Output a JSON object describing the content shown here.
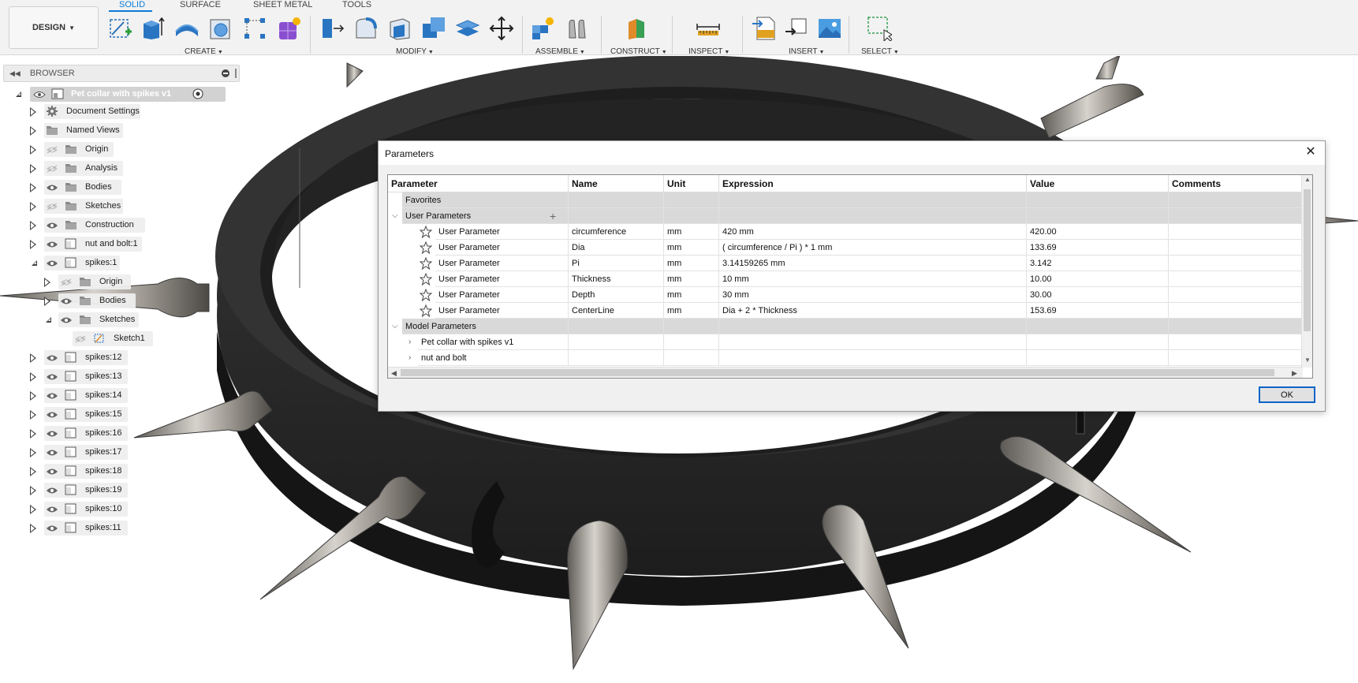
{
  "toolbar": {
    "workspace_label": "DESIGN",
    "tabs": [
      "SOLID",
      "SURFACE",
      "SHEET METAL",
      "TOOLS"
    ],
    "groups": [
      "CREATE",
      "MODIFY",
      "ASSEMBLE",
      "CONSTRUCT",
      "INSPECT",
      "INSERT",
      "SELECT"
    ]
  },
  "browser": {
    "title": "BROWSER",
    "root": "Pet collar with spikes v1",
    "items": [
      "Document Settings",
      "Named Views",
      "Origin",
      "Analysis",
      "Bodies",
      "Sketches",
      "Construction",
      "nut and bolt:1",
      "spikes:1",
      "Origin",
      "Bodies",
      "Sketches",
      "Sketch1",
      "spikes:12",
      "spikes:13",
      "spikes:14",
      "spikes:15",
      "spikes:16",
      "spikes:17",
      "spikes:18",
      "spikes:19",
      "spikes:10",
      "spikes:11"
    ]
  },
  "dialog": {
    "title": "Parameters",
    "close_glyph": "✕",
    "ok_label": "OK",
    "columns": [
      "Parameter",
      "Name",
      "Unit",
      "Expression",
      "Value",
      "Comments"
    ],
    "sections": {
      "favorites": "Favorites",
      "user": "User Parameters",
      "model": "Model Parameters"
    },
    "add_glyph": "+",
    "user_rows": [
      {
        "param": "User Parameter",
        "name": "circumference",
        "unit": "mm",
        "expr": "420 mm",
        "value": "420.00"
      },
      {
        "param": "User Parameter",
        "name": "Dia",
        "unit": "mm",
        "expr": "( circumference / Pi ) * 1 mm",
        "value": "133.69"
      },
      {
        "param": "User Parameter",
        "name": "Pi",
        "unit": "mm",
        "expr": "3.14159265 mm",
        "value": "3.142"
      },
      {
        "param": "User Parameter",
        "name": "Thickness",
        "unit": "mm",
        "expr": "10 mm",
        "value": "10.00"
      },
      {
        "param": "User Parameter",
        "name": "Depth",
        "unit": "mm",
        "expr": "30 mm",
        "value": "30.00"
      },
      {
        "param": "User Parameter",
        "name": "CenterLine",
        "unit": "mm",
        "expr": "Dia + 2 * Thickness",
        "value": "153.69"
      }
    ],
    "model_rows": [
      "Pet collar with spikes v1",
      "nut and bolt"
    ]
  },
  "colors": {
    "accent": "#0a7bd6",
    "section_bg": "#d9d9d9"
  }
}
